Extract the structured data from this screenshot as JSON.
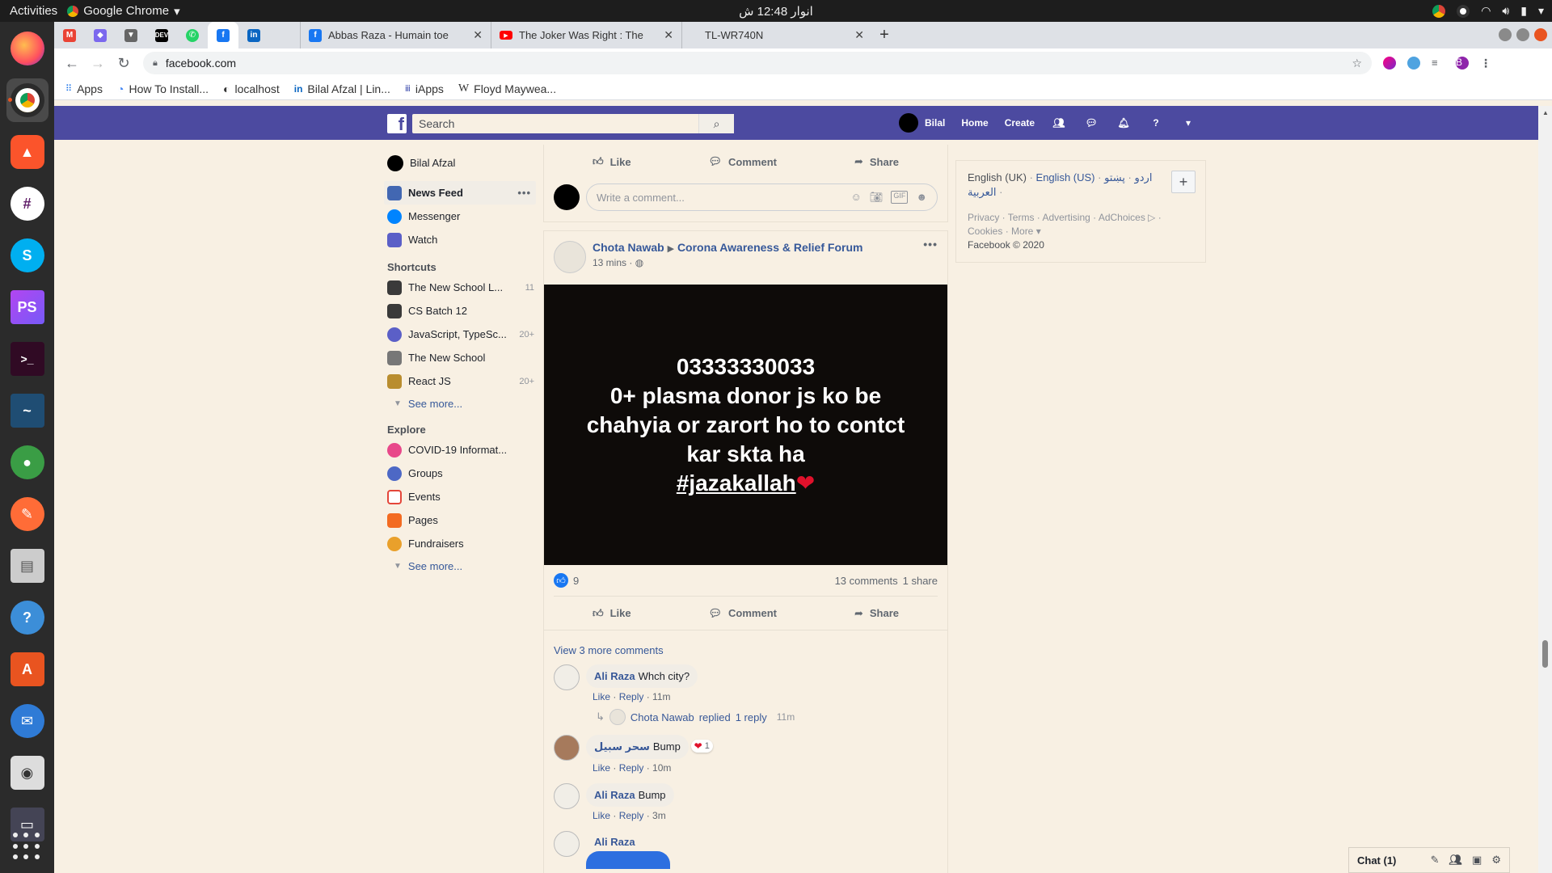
{
  "os": {
    "activities": "Activities",
    "app_name": "Google Chrome",
    "clock": "انوار 12:48 ش"
  },
  "chrome": {
    "tabs": [
      {
        "title": "Abbas Raza - Humain toe",
        "icon": "facebook-icon"
      },
      {
        "title": "The Joker Was Right : The",
        "icon": "youtube-icon"
      },
      {
        "title": "TL-WR740N",
        "icon": "none"
      }
    ],
    "url": "facebook.com",
    "profile_initial": "B",
    "bookmarks": [
      "Apps",
      "How To Install...",
      "localhost",
      "Bilal Afzal | Lin...",
      "iApps",
      "Floyd Maywea..."
    ]
  },
  "fb_header": {
    "logo": "f",
    "search_placeholder": "Search",
    "user": "Bilal",
    "home": "Home",
    "create": "Create"
  },
  "left_nav": {
    "profile": "Bilal Afzal",
    "main": [
      "News Feed",
      "Messenger",
      "Watch"
    ],
    "shortcuts_title": "Shortcuts",
    "shortcuts": [
      {
        "label": "The New School L...",
        "count": "11"
      },
      {
        "label": "CS Batch 12",
        "count": ""
      },
      {
        "label": "JavaScript, TypeSc...",
        "count": "20+"
      },
      {
        "label": "The New School",
        "count": ""
      },
      {
        "label": "React JS",
        "count": "20+"
      }
    ],
    "see_more": "See more...",
    "explore_title": "Explore",
    "explore": [
      "COVID-19 Informat...",
      "Groups",
      "Events",
      "Pages",
      "Fundraisers"
    ]
  },
  "feed": {
    "actions": {
      "like": "Like",
      "comment": "Comment",
      "share": "Share"
    },
    "write_comment": "Write a comment...",
    "post": {
      "author": "Chota Nawab",
      "group": "Corona Awareness & Relief Forum",
      "time": "13 mins",
      "image_lines": [
        "03333330033",
        "0+ plasma donor js ko be",
        "chahyia or zarort ho to contct",
        "kar skta ha"
      ],
      "hashtag": "#jazakallah",
      "heart": "❤",
      "likes": "9",
      "comments_count": "13 comments",
      "shares_count": "1 share",
      "view_more": "View 3 more comments",
      "comments": [
        {
          "name": "Ali Raza",
          "text": "Whch city?",
          "time": "11m"
        },
        {
          "name": "سحر سبیل",
          "text": "Bump",
          "time": "10m",
          "reactions": "1"
        },
        {
          "name": "Ali Raza",
          "text": "Bump",
          "time": "3m"
        },
        {
          "name": "Ali Raza",
          "text": "",
          "time": ""
        }
      ],
      "replied": {
        "name": "Chota Nawab",
        "verb": "replied",
        "link": "1 reply",
        "time": "11m"
      },
      "comment_like": "Like",
      "comment_reply": "Reply"
    }
  },
  "right_col": {
    "lang_current": "English (UK)",
    "lang_links": [
      "English (US)",
      "اردو",
      "پښتو",
      "العربية"
    ],
    "footer_line1": "Privacy · Terms · Advertising · AdChoices ▷ ·",
    "footer_line2": "Cookies · More ▾",
    "copyright": "Facebook © 2020"
  },
  "chat": {
    "label": "Chat (1)"
  },
  "colors": {
    "fb_header": "#4c4aa0",
    "background": "#f8f0e3",
    "link": "#365899"
  }
}
